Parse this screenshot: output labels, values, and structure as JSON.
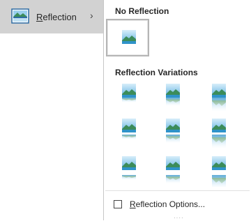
{
  "menu": {
    "item_label_rest": "eflection",
    "item_label_accel": "R",
    "chevron": "›",
    "icon": "picture-icon"
  },
  "flyout": {
    "no_reflection_header": "No Reflection",
    "variations_header": "Reflection Variations",
    "options_label_accel": "R",
    "options_label_rest": "eflection Options...",
    "grip": "····",
    "variations": [
      {
        "id": "tight-touching"
      },
      {
        "id": "half-touching"
      },
      {
        "id": "full-touching"
      },
      {
        "id": "tight-4pt"
      },
      {
        "id": "half-4pt"
      },
      {
        "id": "full-4pt"
      },
      {
        "id": "tight-8pt"
      },
      {
        "id": "half-8pt"
      },
      {
        "id": "full-8pt"
      }
    ]
  },
  "colors": {
    "sky_top": "#c9e6f7",
    "sky_bottom": "#5aaee0",
    "hill": "#3c8c5a",
    "water": "#2f93c9",
    "selected_border": "#b5b5b5",
    "menu_bg": "#d2d2d2"
  }
}
